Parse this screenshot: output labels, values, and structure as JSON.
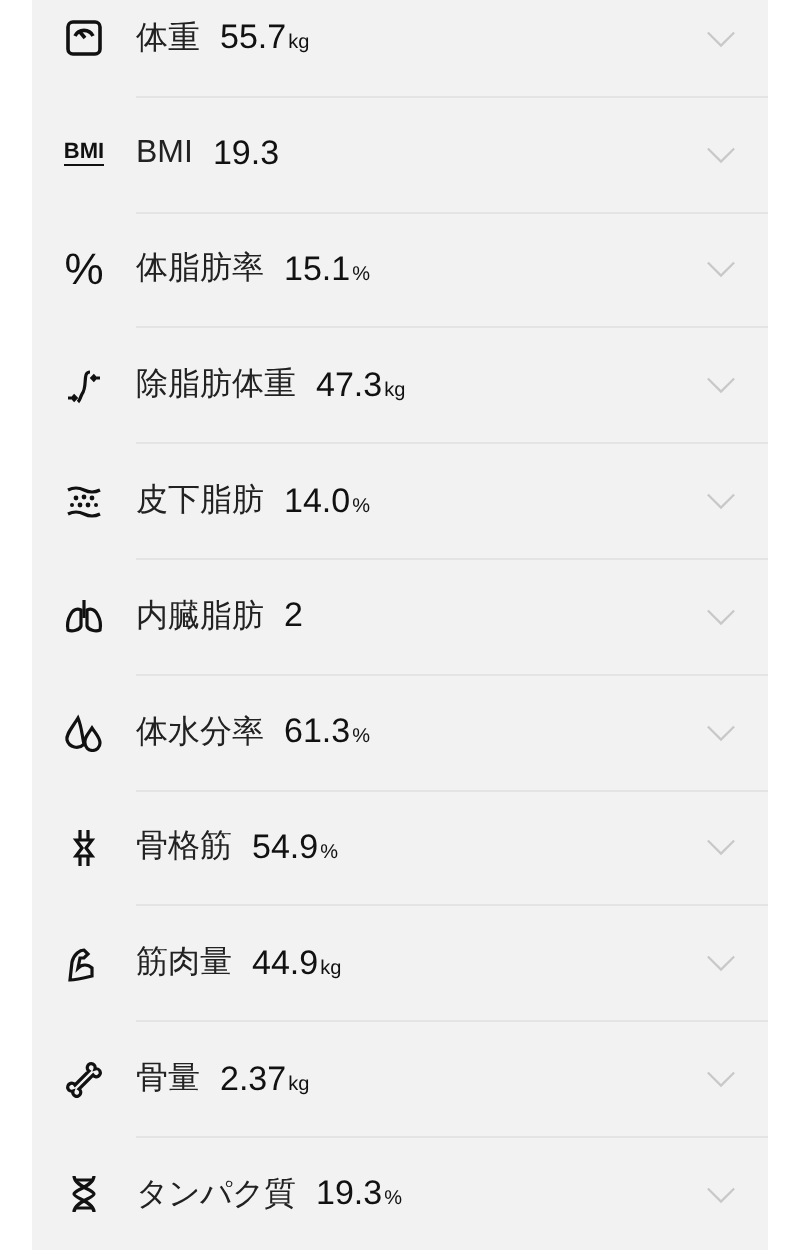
{
  "metrics": [
    {
      "kind": "scale",
      "label": "体重",
      "value": "55.7",
      "unit": "kg"
    },
    {
      "kind": "text",
      "icon_text": "BMI",
      "label": "BMI",
      "value": "19.3"
    },
    {
      "kind": "glyph",
      "icon_text": "%",
      "label": "体脂肪率",
      "value": "15.1",
      "unit": "%"
    },
    {
      "kind": "lean",
      "label": "除脂肪体重",
      "value": "47.3",
      "unit": "kg"
    },
    {
      "kind": "fat",
      "label": "皮下脂肪",
      "value": "14.0",
      "unit": "%"
    },
    {
      "kind": "lungs",
      "label": "内臓脂肪",
      "value": "2"
    },
    {
      "kind": "drops",
      "label": "体水分率",
      "value": "61.3",
      "unit": "%"
    },
    {
      "kind": "joint",
      "label": "骨格筋",
      "value": "54.9",
      "unit": "%"
    },
    {
      "kind": "arm",
      "label": "筋肉量",
      "value": "44.9",
      "unit": "kg"
    },
    {
      "kind": "bone",
      "label": "骨量",
      "value": "2.37",
      "unit": "kg"
    },
    {
      "kind": "dna",
      "label": "タンパク質",
      "value": "19.3",
      "unit": "%"
    }
  ]
}
